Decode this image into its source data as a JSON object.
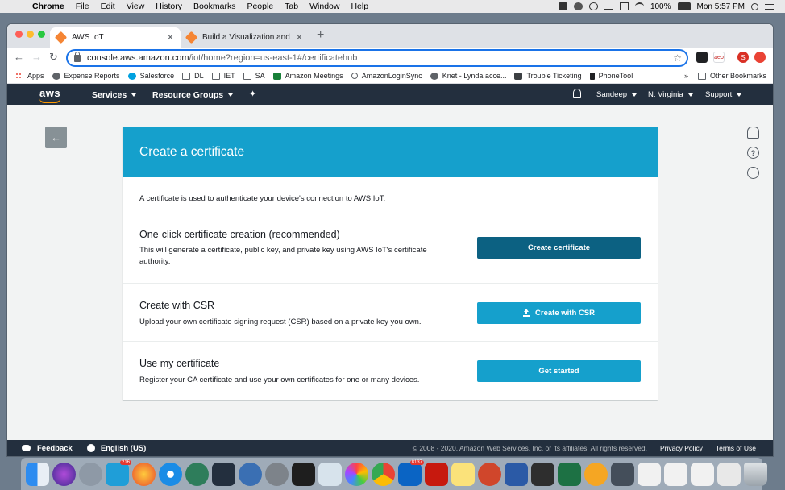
{
  "menubar": {
    "app": "Chrome",
    "items": [
      "File",
      "Edit",
      "View",
      "History",
      "Bookmarks",
      "People",
      "Tab",
      "Window",
      "Help"
    ],
    "battery": "100%",
    "clock": "Mon 5:57 PM"
  },
  "browser": {
    "tabs": [
      {
        "title": "AWS IoT",
        "active": true
      },
      {
        "title": "Build a Visualization and Monit",
        "active": false
      }
    ],
    "url_host": "console.aws.amazon.com",
    "url_path": "/iot/home?region=us-east-1#/certificatehub",
    "profile_initial": "S",
    "ext_label": "aeo",
    "bookmarks": [
      "Apps",
      "Expense Reports",
      "Salesforce",
      "DL",
      "IET",
      "SA",
      "Amazon Meetings",
      "AmazonLoginSync",
      "Knet - Lynda acce...",
      "Trouble Ticketing",
      "PhoneTool"
    ],
    "bookmarks_more": "»",
    "other_bookmarks": "Other Bookmarks"
  },
  "aws_nav": {
    "logo": "aws",
    "services": "Services",
    "resource_groups": "Resource Groups",
    "user": "Sandeep",
    "region": "N. Virginia",
    "support": "Support"
  },
  "page": {
    "back_label": "←",
    "card_title": "Create a certificate",
    "intro": "A certificate is used to authenticate your device's connection to AWS IoT.",
    "sections": [
      {
        "title": "One-click certificate creation (recommended)",
        "description": "This will generate a certificate, public key, and private key using AWS IoT's certificate authority.",
        "button": "Create certificate"
      },
      {
        "title": "Create with CSR",
        "description": "Upload your own certificate signing request (CSR) based on a private key you own.",
        "button": "Create with CSR"
      },
      {
        "title": "Use my certificate",
        "description": "Register your CA certificate and use your own certificates for one or many devices.",
        "button": "Get started"
      }
    ],
    "side_icons": [
      "bell-icon",
      "help-icon",
      "activity-icon"
    ],
    "help_glyph": "?"
  },
  "footer": {
    "feedback": "Feedback",
    "language": "English (US)",
    "copyright": "© 2008 - 2020, Amazon Web Services, Inc. or its affiliates. All rights reserved.",
    "privacy": "Privacy Policy",
    "terms": "Terms of Use"
  },
  "dock": {
    "badges": [
      "216",
      "8137"
    ]
  },
  "colors": {
    "aws_nav_bg": "#232f3e",
    "card_header": "#15a0cc",
    "primary_button": "#0c6182",
    "secondary_button": "#15a0cc",
    "aws_orange": "#ff9900"
  }
}
